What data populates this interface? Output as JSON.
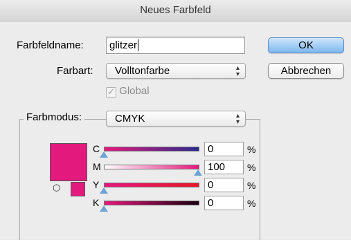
{
  "window": {
    "title": "Neues Farbfeld"
  },
  "form": {
    "name_label": "Farbfeldname:",
    "name_value": "glitzer",
    "type_label": "Farbart:",
    "type_value": "Volltonfarbe",
    "global_label": "Global",
    "global_checked": true,
    "mode_label": "Farbmodus:",
    "mode_value": "CMYK"
  },
  "buttons": {
    "ok": "OK",
    "cancel": "Abbrechen"
  },
  "colors": {
    "swatch": "#e4197d",
    "default_button": "#7db7ef"
  },
  "channels": [
    {
      "label": "C",
      "value": "0",
      "unit": "%",
      "level": 0
    },
    {
      "label": "M",
      "value": "100",
      "unit": "%",
      "level": 1
    },
    {
      "label": "Y",
      "value": "0",
      "unit": "%",
      "level": 0
    },
    {
      "label": "K",
      "value": "0",
      "unit": "%",
      "level": 0
    }
  ]
}
